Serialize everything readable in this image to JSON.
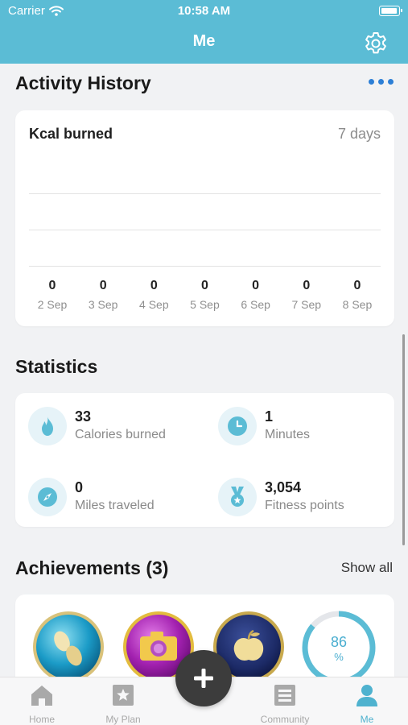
{
  "status_bar": {
    "carrier": "Carrier",
    "time": "10:58 AM"
  },
  "header": {
    "title": "Me"
  },
  "activity": {
    "title": "Activity History",
    "card_title": "Kcal burned",
    "range_label": "7 days",
    "days": [
      {
        "value": "0",
        "date": "2 Sep"
      },
      {
        "value": "0",
        "date": "3 Sep"
      },
      {
        "value": "0",
        "date": "4 Sep"
      },
      {
        "value": "0",
        "date": "5 Sep"
      },
      {
        "value": "0",
        "date": "6 Sep"
      },
      {
        "value": "0",
        "date": "7 Sep"
      },
      {
        "value": "0",
        "date": "8 Sep"
      }
    ]
  },
  "statistics": {
    "title": "Statistics",
    "items": [
      {
        "value": "33",
        "label": "Calories burned",
        "icon": "flame-icon"
      },
      {
        "value": "1",
        "label": "Minutes",
        "icon": "clock-icon"
      },
      {
        "value": "0",
        "label": "Miles traveled",
        "icon": "compass-icon"
      },
      {
        "value": "3,054",
        "label": "Fitness points",
        "icon": "medal-icon"
      }
    ]
  },
  "achievements": {
    "title": "Achievements (3)",
    "show_all": "Show all",
    "badges": [
      "footprints-badge",
      "camera-badge",
      "apple-badge"
    ],
    "progress": {
      "value": "86",
      "unit": "%",
      "fraction": 0.86
    }
  },
  "tabbar": {
    "items": [
      {
        "label": "Home",
        "icon": "home-icon"
      },
      {
        "label": "My Plan",
        "icon": "star-icon"
      },
      {
        "label": "Community",
        "icon": "community-icon"
      },
      {
        "label": "Me",
        "icon": "person-icon"
      }
    ]
  },
  "colors": {
    "accent": "#5bbcd5",
    "link": "#2c7fd6",
    "fab": "#3c3c3c"
  }
}
